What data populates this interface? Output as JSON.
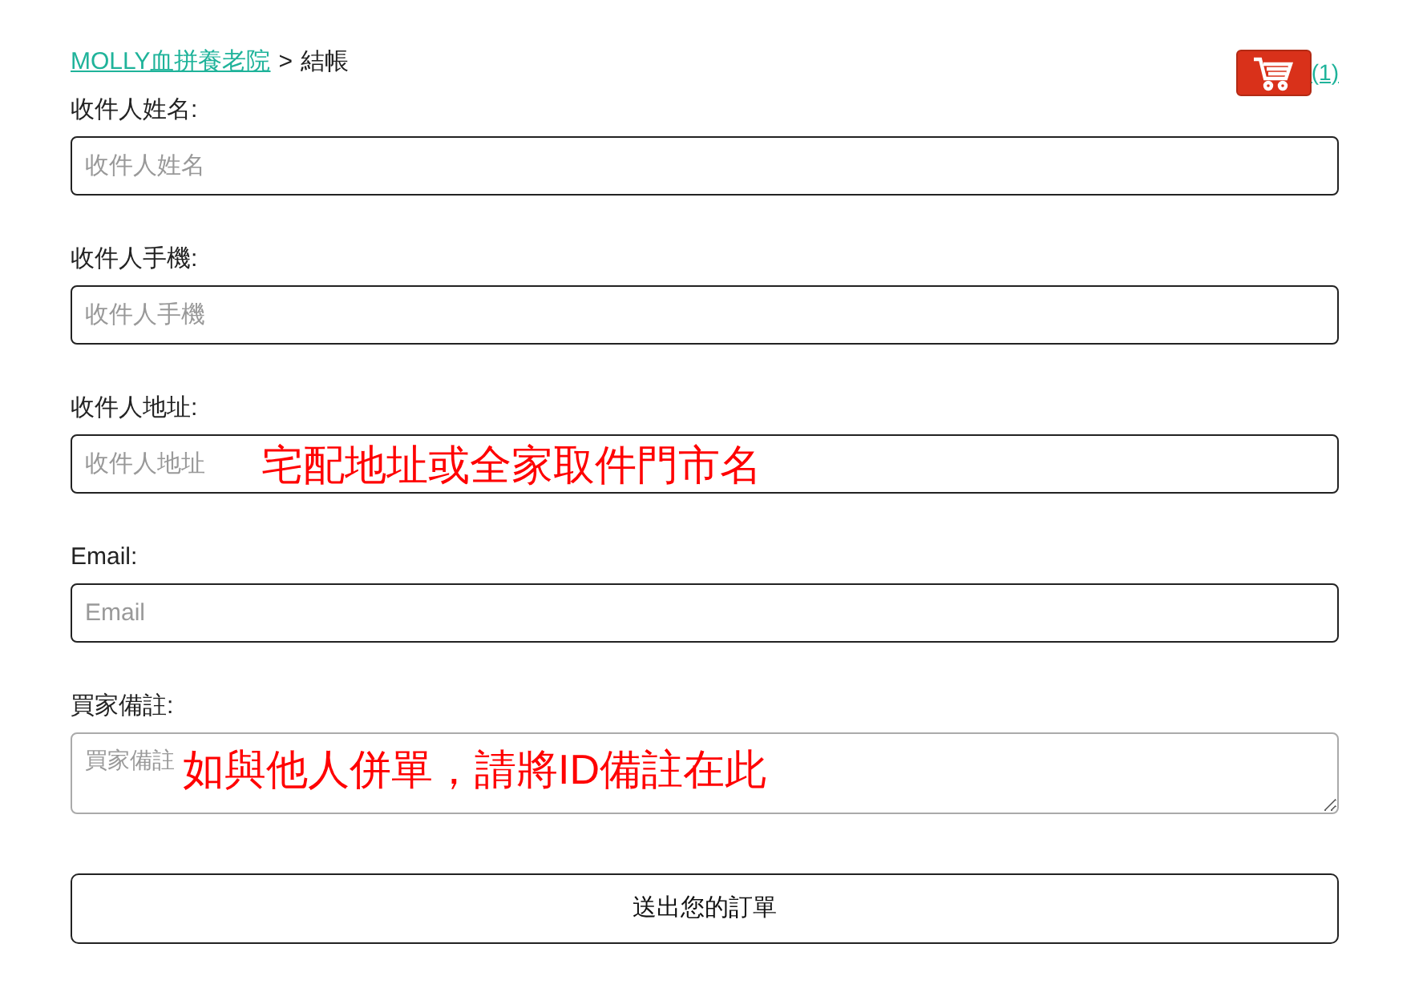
{
  "breadcrumb": {
    "link": "MOLLY血拼養老院",
    "separator": ">",
    "current": "結帳"
  },
  "cart": {
    "count": "(1)"
  },
  "fields": [
    {
      "kind": "input",
      "label": "收件人姓名:",
      "placeholder": "收件人姓名"
    },
    {
      "kind": "input",
      "label": "收件人手機:",
      "placeholder": "收件人手機"
    },
    {
      "kind": "input",
      "label": "收件人地址:",
      "placeholder": "收件人地址",
      "annotation": "宅配地址或全家取件門市名"
    },
    {
      "kind": "input",
      "label": "Email:",
      "placeholder": "Email"
    },
    {
      "kind": "textarea",
      "label": "買家備註:",
      "placeholder": "買家備註",
      "annotation": "如與他人併單，請將ID備註在此"
    }
  ],
  "submit": {
    "label": "送出您的訂單"
  }
}
